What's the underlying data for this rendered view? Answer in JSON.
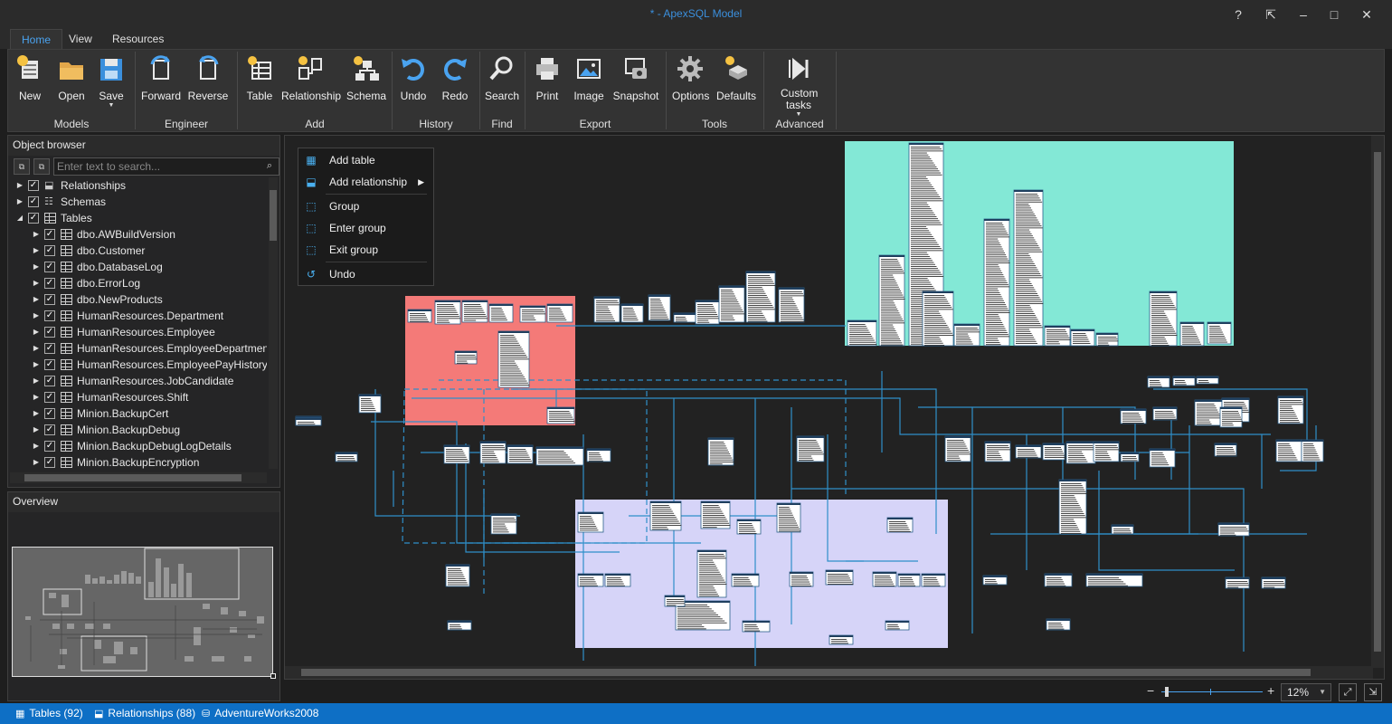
{
  "window": {
    "title": "* - ApexSQL Model"
  },
  "tabs": [
    "Home",
    "View",
    "Resources"
  ],
  "ribbon": {
    "groups": [
      {
        "label": "Models",
        "buttons": [
          {
            "label": "New",
            "icon": "new-model-icon"
          },
          {
            "label": "Open",
            "icon": "open-folder-icon"
          },
          {
            "label": "Save",
            "icon": "save-icon",
            "dropdown": true
          }
        ]
      },
      {
        "label": "Engineer",
        "buttons": [
          {
            "label": "Forward",
            "icon": "forward-engineer-icon"
          },
          {
            "label": "Reverse",
            "icon": "reverse-engineer-icon"
          }
        ]
      },
      {
        "label": "Add",
        "buttons": [
          {
            "label": "Table",
            "icon": "add-table-icon"
          },
          {
            "label": "Relationship",
            "icon": "add-relationship-icon"
          },
          {
            "label": "Schema",
            "icon": "add-schema-icon"
          }
        ]
      },
      {
        "label": "History",
        "buttons": [
          {
            "label": "Undo",
            "icon": "undo-icon"
          },
          {
            "label": "Redo",
            "icon": "redo-icon"
          }
        ]
      },
      {
        "label": "Find",
        "buttons": [
          {
            "label": "Search",
            "icon": "search-icon"
          }
        ]
      },
      {
        "label": "Export",
        "buttons": [
          {
            "label": "Print",
            "icon": "print-icon"
          },
          {
            "label": "Image",
            "icon": "image-icon"
          },
          {
            "label": "Snapshot",
            "icon": "snapshot-icon"
          }
        ]
      },
      {
        "label": "Tools",
        "buttons": [
          {
            "label": "Options",
            "icon": "gear-icon"
          },
          {
            "label": "Defaults",
            "icon": "defaults-icon"
          }
        ]
      },
      {
        "label": "Advanced",
        "buttons": [
          {
            "label": "Custom tasks",
            "icon": "custom-tasks-icon",
            "dropdown": true
          }
        ]
      }
    ]
  },
  "object_browser": {
    "title": "Object browser",
    "search_placeholder": "Enter text to search...",
    "tree": [
      {
        "label": "Relationships",
        "level": 0,
        "expanded": false,
        "icon": "relationship-icon"
      },
      {
        "label": "Schemas",
        "level": 0,
        "expanded": false,
        "icon": "schema-icon"
      },
      {
        "label": "Tables",
        "level": 0,
        "expanded": true,
        "icon": "table-icon"
      },
      {
        "label": "dbo.AWBuildVersion",
        "level": 1
      },
      {
        "label": "dbo.Customer",
        "level": 1
      },
      {
        "label": "dbo.DatabaseLog",
        "level": 1
      },
      {
        "label": "dbo.ErrorLog",
        "level": 1
      },
      {
        "label": "dbo.NewProducts",
        "level": 1
      },
      {
        "label": "HumanResources.Department",
        "level": 1
      },
      {
        "label": "HumanResources.Employee",
        "level": 1
      },
      {
        "label": "HumanResources.EmployeeDepartmentHis",
        "level": 1
      },
      {
        "label": "HumanResources.EmployeePayHistory",
        "level": 1
      },
      {
        "label": "HumanResources.JobCandidate",
        "level": 1
      },
      {
        "label": "HumanResources.Shift",
        "level": 1
      },
      {
        "label": "Minion.BackupCert",
        "level": 1
      },
      {
        "label": "Minion.BackupDebug",
        "level": 1
      },
      {
        "label": "Minion.BackupDebugLogDetails",
        "level": 1
      },
      {
        "label": "Minion.BackupEncryption",
        "level": 1
      }
    ]
  },
  "overview": {
    "title": "Overview"
  },
  "context_menu": {
    "items": [
      {
        "label": "Add table",
        "icon": "add-table-icon"
      },
      {
        "label": "Add relationship",
        "icon": "add-relationship-icon",
        "submenu": true
      },
      {
        "label": "Group",
        "icon": "group-icon"
      },
      {
        "label": "Enter group",
        "icon": "enter-group-icon"
      },
      {
        "label": "Exit group",
        "icon": "exit-group-icon"
      },
      {
        "label": "Undo",
        "icon": "undo-icon"
      }
    ]
  },
  "diagram": {
    "group_colors": {
      "teal": "#83e8d6",
      "red": "#f47a78",
      "lavender": "#d6d4f8"
    },
    "line_color": "#2f8fc9"
  },
  "zoom": {
    "value": "12%"
  },
  "status": {
    "tables": "Tables (92)",
    "relationships": "Relationships (88)",
    "database": "AdventureWorks2008"
  },
  "colors": {
    "accent": "#0e6fc5",
    "title": "#3b8fdc",
    "background": "#1e1e1e"
  }
}
